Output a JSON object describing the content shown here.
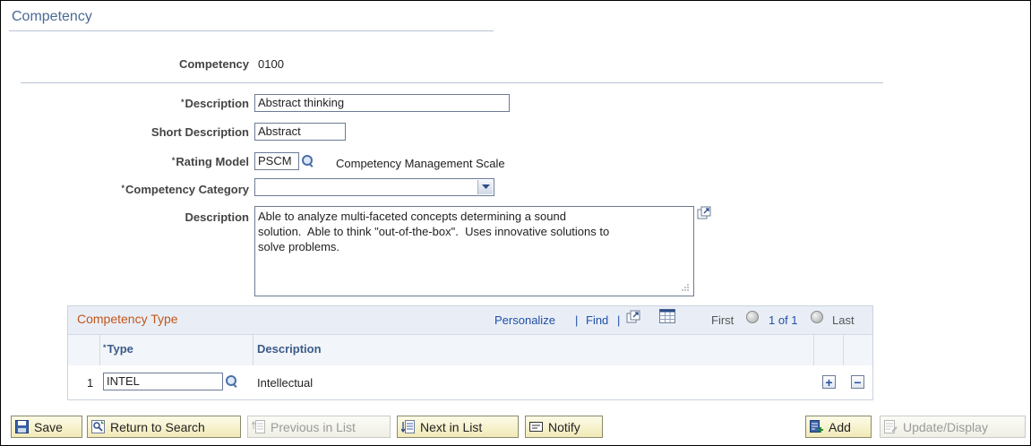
{
  "page": {
    "title": "Competency"
  },
  "fields": {
    "competency": {
      "label": "Competency",
      "value": "0100"
    },
    "description": {
      "label": "Description",
      "value": "Abstract thinking",
      "required": "*"
    },
    "short_description": {
      "label": "Short Description",
      "value": "Abstract"
    },
    "rating_model": {
      "label": "Rating Model",
      "value": "PSCM",
      "desc": "Competency Management Scale",
      "required": "*"
    },
    "competency_category": {
      "label": "Competency Category",
      "value": "",
      "required": "*"
    },
    "long_description": {
      "label": "Description",
      "value": "Able to analyze multi-faceted concepts determining a sound\nsolution.  Able to think \"out-of-the-box\".  Uses innovative solutions to\nsolve problems."
    }
  },
  "grid": {
    "title": "Competency Type",
    "personalize": "Personalize",
    "find": "Find",
    "first": "First",
    "range": "1 of 1",
    "last": "Last",
    "columns": {
      "type": "Type",
      "description": "Description",
      "type_required": "*"
    },
    "rows": [
      {
        "num": "1",
        "type": "INTEL",
        "description": "Intellectual"
      }
    ]
  },
  "toolbar": {
    "save": "Save",
    "return_to_search": "Return to Search",
    "previous_in_list": "Previous in List",
    "next_in_list": "Next in List",
    "notify": "Notify",
    "add": "Add",
    "update_display": "Update/Display"
  },
  "colors": {
    "title": "#4a6a94",
    "grid_title": "#c2561b",
    "link": "#1f4fa8",
    "toolbar_bg": "#f1e9b6"
  }
}
